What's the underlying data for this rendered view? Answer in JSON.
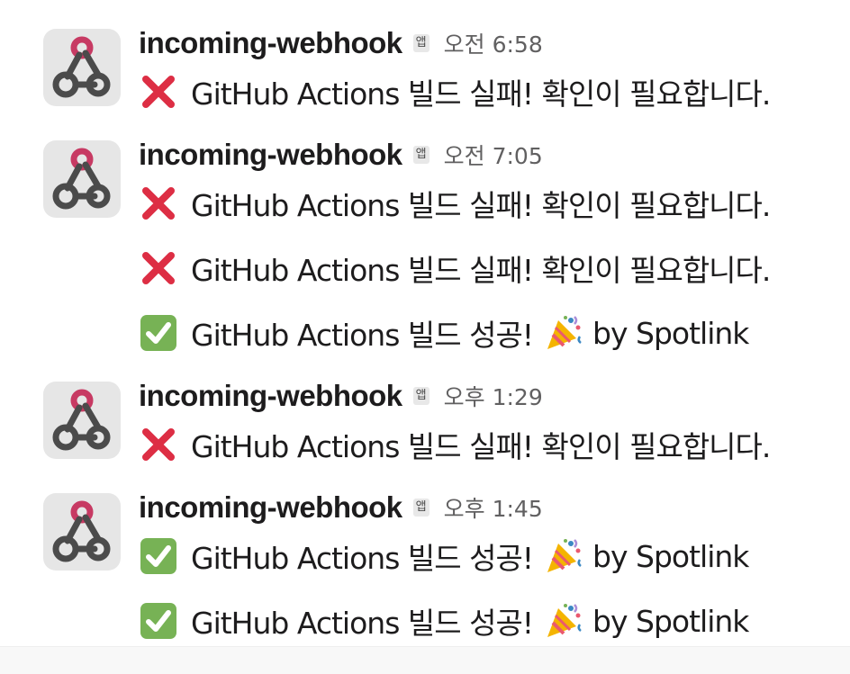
{
  "colors": {
    "sender": "#1d1c1d",
    "timestamp": "#616061",
    "badge_bg": "#e8e8e8",
    "avatar_bg": "#e6e6e6",
    "webhook_pink": "#c73a63",
    "webhook_dark": "#4b4b4b",
    "failure_red": "#dd2e44",
    "success_green": "#77b255"
  },
  "icons": {
    "avatar": "webhook-icon",
    "failure": "cross-mark-icon",
    "success": "check-mark-icon",
    "celebration": "party-popper-icon"
  },
  "messages": [
    {
      "sender": "incoming-webhook",
      "badge": "앱",
      "time": "오전 6:58",
      "lines": [
        "GitHub Actions 빌드 실패! 확인이 필요합니다."
      ]
    },
    {
      "sender": "incoming-webhook",
      "badge": "앱",
      "time": "오전 7:05",
      "lines": [
        "GitHub Actions 빌드 실패! 확인이 필요합니다.",
        "GitHub Actions 빌드 실패! 확인이 필요합니다.",
        "GitHub Actions 빌드 성공!"
      ],
      "line_suffix": "by Spotlink"
    },
    {
      "sender": "incoming-webhook",
      "badge": "앱",
      "time": "오후 1:29",
      "lines": [
        "GitHub Actions 빌드 실패! 확인이 필요합니다."
      ]
    },
    {
      "sender": "incoming-webhook",
      "badge": "앱",
      "time": "오후 1:45",
      "lines": [
        "GitHub Actions 빌드 성공!",
        "GitHub Actions 빌드 성공!"
      ],
      "line_suffix": "by Spotlink"
    }
  ]
}
